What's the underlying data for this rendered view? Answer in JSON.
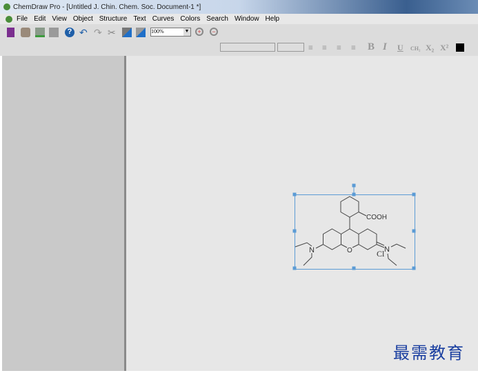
{
  "window": {
    "title": "ChemDraw Pro - [Untitled J. Chin. Chem. Soc. Document-1 *]"
  },
  "menu": [
    "File",
    "Edit",
    "View",
    "Object",
    "Structure",
    "Text",
    "Curves",
    "Colors",
    "Search",
    "Window",
    "Help"
  ],
  "toolbar": {
    "zoom_value": "100%",
    "icons": [
      "new-document-icon",
      "open-icon",
      "save-icon",
      "print-icon",
      "help-icon",
      "undo-icon",
      "redo-icon",
      "cut-icon",
      "copy-icon",
      "paste-icon",
      "zoom-in-icon",
      "zoom-out-icon"
    ]
  },
  "format_bar": {
    "font_value": "",
    "size_value": "",
    "bold": "B",
    "italic": "I",
    "underline": "U",
    "formula": "CH₂",
    "subscript": "X₂",
    "superscript": "X²",
    "color": "#000000"
  },
  "molecule": {
    "acid_label": "COOH",
    "n_left": "N",
    "n_right": "N",
    "o_label": "O",
    "counter_ion": "Cl"
  },
  "watermark": "最需教育"
}
